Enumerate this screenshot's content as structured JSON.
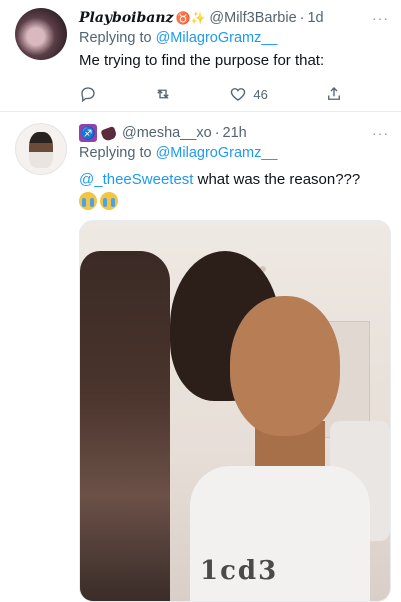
{
  "tweets": [
    {
      "display_name": "Playboibanz",
      "name_emojis": "♉✨",
      "handle": "@Milf3Barbie",
      "time": "1d",
      "reply_prefix": "Replying to ",
      "reply_to": "@MilagroGramz__",
      "text": "Me trying to find the purpose for that:",
      "likes": "46"
    },
    {
      "handle": "@mesha__xo",
      "time": "21h",
      "reply_prefix": "Replying to ",
      "reply_to": "@MilagroGramz__",
      "mention": "@_theeSweetest",
      "text": " what was the reason???",
      "badge_a": "♐"
    }
  ],
  "ui": {
    "separator": "·",
    "more": "···"
  },
  "media_print": "1cd3",
  "colors": {
    "link": "#1d9bf0",
    "secondary": "#536471"
  }
}
